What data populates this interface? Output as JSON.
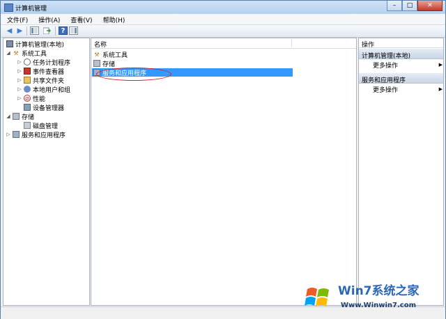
{
  "window": {
    "title": "计算机管理",
    "minimize": "–",
    "maximize": "□",
    "close": "✕"
  },
  "menu": [
    "文件(F)",
    "操作(A)",
    "查看(V)",
    "帮助(H)"
  ],
  "toolbar": {
    "back": "◀",
    "forward": "▶",
    "help": "?"
  },
  "tree": {
    "root": "计算机管理(本地)",
    "system_tools": "系统工具",
    "task_scheduler": "任务计划程序",
    "event_viewer": "事件查看器",
    "shared_folders": "共享文件夹",
    "local_users": "本地用户和组",
    "performance": "性能",
    "device_manager": "设备管理器",
    "storage": "存储",
    "disk_management": "磁盘管理",
    "services_apps": "服务和应用程序"
  },
  "list": {
    "column_name": "名称",
    "items": [
      "系统工具",
      "存储",
      "服务和应用程序"
    ]
  },
  "actions": {
    "header": "操作",
    "section1": "计算机管理(本地)",
    "more1": "更多操作",
    "section2": "服务和应用程序",
    "more2": "更多操作"
  },
  "watermark": {
    "title": "Win7系统之家",
    "url": "Www.Winwin7.com"
  },
  "colors": {
    "selection": "#3399ff",
    "highlight_circle": "#d6202a",
    "watermark_blue": "#2a67b9"
  }
}
